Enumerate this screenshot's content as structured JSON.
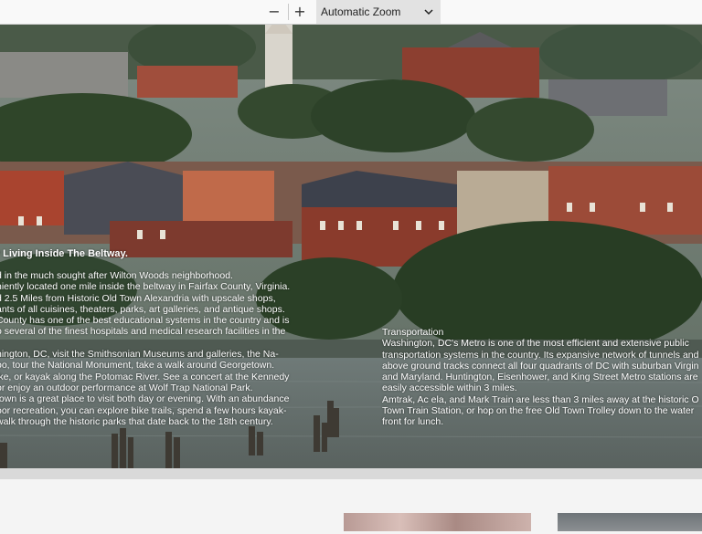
{
  "toolbar": {
    "zoom_out_label": "−",
    "zoom_in_label": "+",
    "zoom_value": "Automatic Zoom"
  },
  "page": {
    "left_heading": "y Living Inside The Beltway.",
    "left_paragraphs": [
      "d in the much sought after Wilton Woods neighborhood.",
      "niently located one mile inside the beltway in Fairfax County, Virginia.",
      "d 2.5 Miles from Historic Old Town Alexandria with upscale shops,",
      "ants of all cuisines, theaters, parks, art galleries, and antique shops.",
      "County has one of the best educational systems in the country and is",
      "o several of the finest hospitals and medical research facilities in the",
      "",
      "hington, DC, visit the Smithsonian Museums and galleries, the Na-",
      "oo, tour the National Monument, take a walk around Georgetown.",
      "ike, or kayak along the Potomac River. See a concert at the Kennedy",
      "or enjoy an outdoor performance at Wolf Trap National Park.",
      "town is a great place to visit both day or evening. With an abundance",
      "oor recreation, you can explore bike trails, spend a few hours kayak-",
      "walk through the historic parks that date back to the 18th century."
    ],
    "right_heading": "Transportation",
    "right_paragraphs": [
      "Washington, DC's Metro is one of the most efficient and extensive public",
      "transportation systems in the country. Its expansive network of tunnels and",
      "above ground tracks connect all four quadrants of DC with suburban Virgin",
      "and Maryland. Huntington, Eisenhower, and King Street Metro stations are",
      "easily accessible within 3 miles.",
      "Amtrak, Ac ela, and Mark Train are less than 3 miles away at the historic O",
      "Town Train Station, or hop on the free Old Town Trolley down to the water",
      "front for lunch."
    ]
  }
}
